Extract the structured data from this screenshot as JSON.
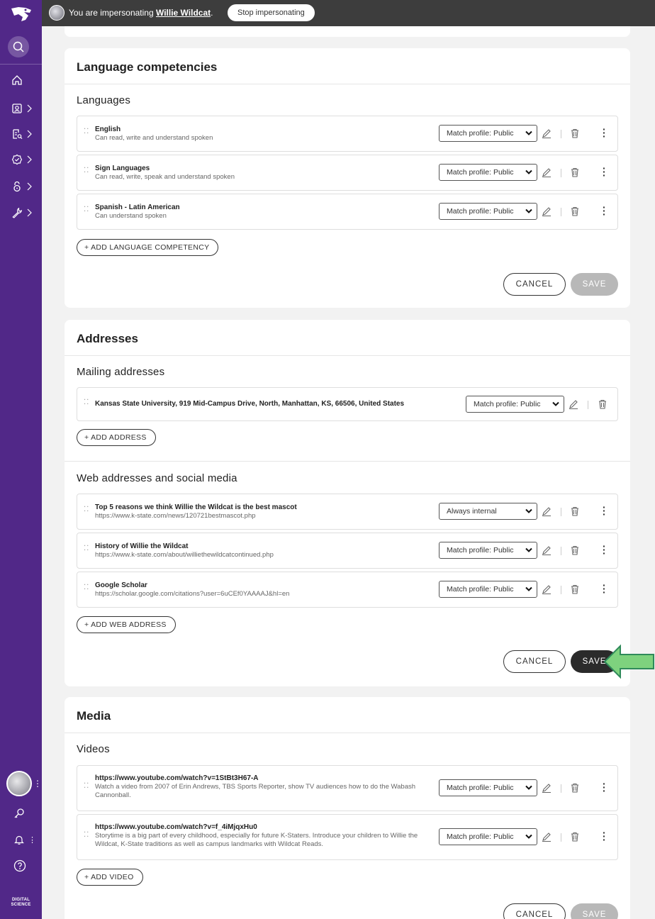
{
  "colors": {
    "sidebar": "#512888",
    "topbar": "#3d3d3d",
    "save_active": "#2b2b2b",
    "save_disabled": "#b8b8b8",
    "arrow": "#7ed27e"
  },
  "impersonation": {
    "prefix": "You are impersonating ",
    "name": "Willie Wildcat",
    "suffix": ".",
    "stop_label": "Stop impersonating"
  },
  "sidebar": {
    "footer_logo_line1": "DIGITAL",
    "footer_logo_line2": "SCIENCE"
  },
  "language": {
    "title": "Language competencies",
    "subhead": "Languages",
    "items": [
      {
        "title": "English",
        "sub": "Can read, write and understand spoken",
        "visibility": "Match profile: Public"
      },
      {
        "title": "Sign Languages",
        "sub": "Can read, write, speak and understand spoken",
        "visibility": "Match profile: Public"
      },
      {
        "title": "Spanish - Latin American",
        "sub": "Can understand spoken",
        "visibility": "Match profile: Public"
      }
    ],
    "add_label": "ADD LANGUAGE COMPETENCY",
    "cancel_label": "CANCEL",
    "save_label": "SAVE"
  },
  "addresses": {
    "title": "Addresses",
    "mailing_subhead": "Mailing addresses",
    "mailing": [
      {
        "title": "Kansas State University, 919 Mid-Campus Drive, North, Manhattan, KS, 66506, United States",
        "visibility": "Match profile: Public"
      }
    ],
    "add_address_label": "ADD ADDRESS",
    "web_subhead": "Web addresses and social media",
    "web": [
      {
        "title": "Top 5 reasons we think Willie the Wildcat is the best mascot",
        "sub": "https://www.k-state.com/news/120721bestmascot.php",
        "visibility": "Always internal"
      },
      {
        "title": "History of Willie the Wildcat",
        "sub": "https://www.k-state.com/about/williethewildcatcontinued.php",
        "visibility": "Match profile: Public"
      },
      {
        "title": "Google Scholar",
        "sub": "https://scholar.google.com/citations?user=6uCEf0YAAAAJ&hl=en",
        "visibility": "Match profile: Public"
      }
    ],
    "add_web_label": "ADD WEB ADDRESS",
    "cancel_label": "CANCEL",
    "save_label": "SAVE"
  },
  "media": {
    "title": "Media",
    "subhead": "Videos",
    "videos": [
      {
        "title": "https://www.youtube.com/watch?v=1StBt3H67-A",
        "sub": "Watch a video from 2007 of Erin Andrews, TBS Sports Reporter, show TV audiences how to do the Wabash Cannonball.",
        "visibility": "Match profile: Public"
      },
      {
        "title": "https://www.youtube.com/watch?v=f_4iMjqxHu0",
        "sub": "Storytime is a big part of every childhood, especially for future K-Staters. Introduce your children to Willie the Wildcat, K-State traditions as well as campus landmarks with Wildcat Reads.",
        "visibility": "Match profile: Public"
      }
    ],
    "add_label": "ADD VIDEO",
    "cancel_label": "CANCEL",
    "save_label": "SAVE"
  }
}
